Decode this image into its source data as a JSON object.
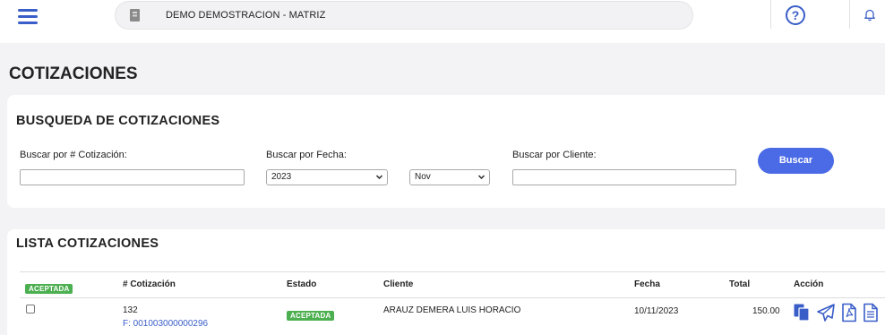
{
  "header": {
    "company_name": "DEMO DEMOSTRACION - MATRIZ",
    "help_symbol": "?",
    "icons": [
      "menu-icon",
      "building-icon",
      "help-icon",
      "bell-icon"
    ]
  },
  "page": {
    "title": "COTIZACIONES"
  },
  "search": {
    "title": "BUSQUEDA DE COTIZACIONES",
    "quote_label": "Buscar por # Cotización:",
    "quote_value": "",
    "date_label": "Buscar por Fecha:",
    "year_value": "2023",
    "month_value": "Nov",
    "client_label": "Buscar por Cliente:",
    "client_value": "",
    "button_label": "Buscar"
  },
  "list": {
    "title": "LISTA COTIZACIONES",
    "status_filter_badge": "ACEPTADA",
    "columns": [
      "# Cotización",
      "Estado",
      "Cliente",
      "Fecha",
      "Total",
      "Acción"
    ],
    "rows": [
      {
        "number": "132",
        "invoice": "F: 001003000000296",
        "status": "ACEPTADA",
        "client": "ARAUZ DEMERA LUIS HORACIO",
        "date": "10/11/2023",
        "total": "150.00",
        "actions": [
          "copy-icon",
          "send-icon",
          "pdf-icon",
          "document-icon"
        ]
      }
    ]
  },
  "colors": {
    "primary": "#3a5ec8",
    "button": "#4a6ae6",
    "badge_green": "#4caf50",
    "background": "#f3f3f5"
  }
}
